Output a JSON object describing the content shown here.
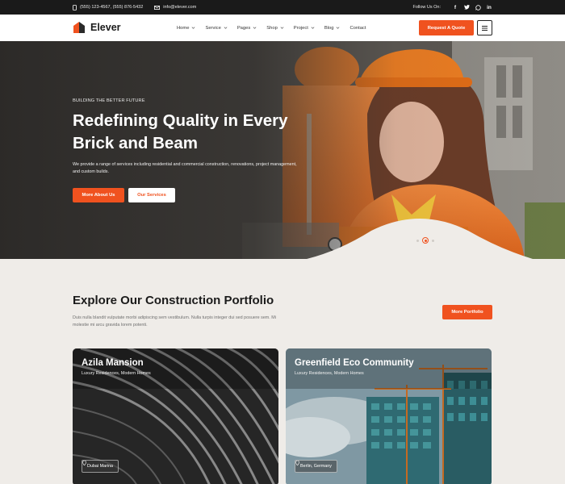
{
  "topbar": {
    "phones": "(555) 123-4567,  (555) 876-5432",
    "email": "info@elever.com",
    "follow": "Follow Us On:",
    "socials": [
      "facebook-icon",
      "twitter-icon",
      "whatsapp-icon",
      "linkedin-icon"
    ]
  },
  "header": {
    "logo": "Elever",
    "nav": [
      "Home",
      "Service",
      "Pages",
      "Shop",
      "Project",
      "Blog",
      "Contact"
    ],
    "cta": "Request A Quote"
  },
  "hero": {
    "eyebrow": "BUILDING THE BETTER FUTURE",
    "title": "Redefining Quality in Every Brick and Beam",
    "description": "We provide a range of services including residential and commercial construction, renovations, project management, and custom builds.",
    "primary_button": "More About Us",
    "secondary_button": "Our Services"
  },
  "portfolio": {
    "title": "Explore Our Construction Portfolio",
    "description": "Duis nulla blandit vulputate morbi adipiscing sem vestibulum. Nulla turpis integer dui sed posuere sem. Mi molestie mi arcu gravida lorem potenti.",
    "button": "More Portfolio",
    "cards": [
      {
        "title": "Azila Mansion",
        "subtitle": "Luxury Residences, Modern Homes",
        "location": "Dubai Marina"
      },
      {
        "title": "Greenfield Eco Community",
        "subtitle": "Luxury Residences, Modern Homes",
        "location": "Berlin, Germany"
      }
    ]
  },
  "colors": {
    "accent": "#f0521f",
    "dark": "#1a1a1a",
    "background": "#efece8"
  }
}
